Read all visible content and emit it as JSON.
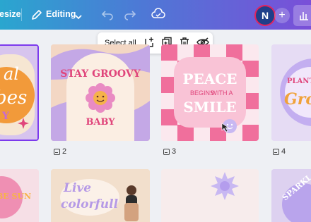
{
  "toolbar": {
    "resize_label": "esize",
    "mode_label": "Editing",
    "avatar_initial": "N",
    "colors": {
      "gradient_start": "#2aa6cf",
      "gradient_end": "#7a4fd8",
      "avatar_ring": "#e0245e",
      "avatar_bg": "#1f3f8a"
    }
  },
  "selection_toolbar": {
    "select_all_label": "Select all",
    "icons": [
      "add-page-icon",
      "duplicate-icon",
      "trash-icon",
      "hide-icon"
    ]
  },
  "pages": [
    {
      "number": "",
      "text": [
        "al",
        "bes",
        "Y"
      ],
      "selected": true
    },
    {
      "number": "2",
      "text": [
        "STAY GROOVY",
        "BABY"
      ]
    },
    {
      "number": "3",
      "text": [
        "PEACE",
        "BEGINS",
        "WITH A",
        "SMILE"
      ]
    },
    {
      "number": "4",
      "text": [
        "PLANT",
        "Gro"
      ]
    }
  ],
  "bottom_pages": [
    {
      "text": [
        "BE SUN"
      ]
    },
    {
      "text": [
        "Live",
        "colorfull"
      ]
    },
    {
      "text": []
    },
    {
      "text": [
        "SPARKL"
      ]
    }
  ]
}
